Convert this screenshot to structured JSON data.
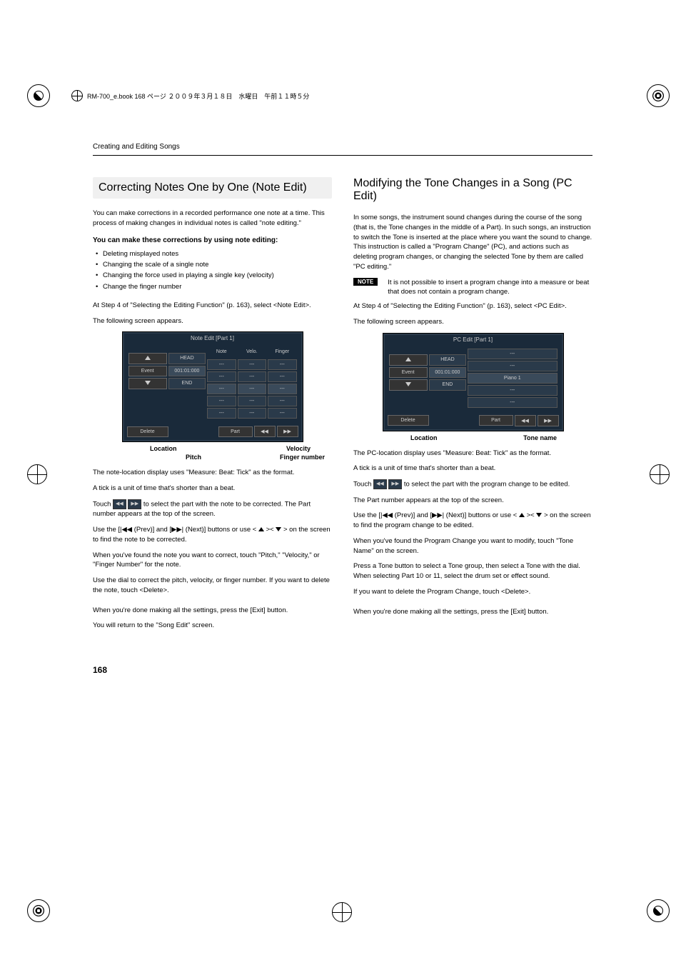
{
  "print_header": "RM-700_e.book  168 ページ  ２００９年３月１８日　水曜日　午前１１時５分",
  "header": "Creating and Editing Songs",
  "left": {
    "title": "Correcting Notes One by One (Note Edit)",
    "intro": "You can make corrections in a recorded performance one note at a time. This process of making changes in individual notes is called \"note editing.\"",
    "bold": "You can make these corrections by using note editing:",
    "bullets": [
      "Deleting misplayed notes",
      "Changing the scale of a single note",
      "Changing the force used in playing a single key (velocity)",
      "Change the finger number"
    ],
    "step": "At Step 4 of \"Selecting the Editing Function\" (p. 163), select <Note Edit>.",
    "appears": "The following screen appears.",
    "screen": {
      "title": "Note Edit [Part 1]",
      "hdr": [
        "Note",
        "Velo.",
        "Finger"
      ],
      "rows": [
        {
          "b": "",
          "l": "",
          "c": [
            "---",
            "---",
            "---"
          ]
        },
        {
          "b": "↑",
          "l": "HEAD",
          "c": [
            "---",
            "---",
            "---"
          ]
        },
        {
          "b": "Event",
          "l": "001:01:000",
          "c": [
            "---",
            "---",
            "---"
          ],
          "sel": true
        },
        {
          "b": "↓",
          "l": "END",
          "c": [
            "---",
            "---",
            "---"
          ]
        },
        {
          "b": "",
          "l": "",
          "c": [
            "---",
            "---",
            "---"
          ]
        }
      ],
      "delete": "Delete",
      "part": "Part"
    },
    "lbl_location": "Location",
    "lbl_velocity": "Velocity",
    "lbl_pitch": "Pitch",
    "lbl_finger": "Finger number",
    "p1": "The note-location display uses \"Measure: Beat: Tick\" as the format.",
    "p2": "A tick is a unit of time that's shorter than a beat.",
    "p3a": "Touch ",
    "p3b": " to select the part with the note to be corrected. The Part number appears at the top of the screen.",
    "p4a": "Use the [",
    "p4b": " (Prev)] and [",
    "p4c": " (Next)] buttons or use < ",
    "p4d": " >< ",
    "p4e": " > on the screen to find the note to be corrected.",
    "p5": "When you've found the note you want to correct, touch \"Pitch,\" \"Velocity,\" or \"Finger Number\" for the note.",
    "p6": "Use the dial to correct the pitch, velocity, or finger number. If you want to delete the note, touch <Delete>.",
    "p7": "When you're done making all the settings, press the [Exit] button.",
    "p8": "You will return to the \"Song Edit\" screen."
  },
  "right": {
    "title": "Modifying the Tone Changes in a Song (PC Edit)",
    "intro": "In some songs, the instrument sound changes during the course of the song (that is, the Tone changes in the middle of a Part). In such songs, an instruction to switch the Tone is inserted at the place where you want the sound to change. This instruction is called a \"Program Change\" (PC), and actions such as deleting program changes, or changing the selected Tone by them are called \"PC editing.\"",
    "note_label": "NOTE",
    "note": "It is not possible to insert a program change into a measure or beat that does not contain a program change.",
    "step": "At Step 4 of \"Selecting the Editing Function\" (p. 163), select <PC Edit>.",
    "appears": "The following screen appears.",
    "screen": {
      "title": "PC Edit [Part 1]",
      "rows": [
        {
          "b": "",
          "l": "",
          "c": "---"
        },
        {
          "b": "↑",
          "l": "HEAD",
          "c": "---"
        },
        {
          "b": "Event",
          "l": "001:01:000",
          "c": "Piano 1",
          "sel": true
        },
        {
          "b": "↓",
          "l": "END",
          "c": "---"
        },
        {
          "b": "",
          "l": "",
          "c": "---"
        }
      ],
      "delete": "Delete",
      "part": "Part"
    },
    "lbl_location": "Location",
    "lbl_tone": "Tone name",
    "p1": "The PC-location display uses \"Measure: Beat: Tick\" as the format.",
    "p2": "A tick is a unit of time that's shorter than a beat.",
    "p3a": "Touch ",
    "p3b": " to select the part with the program change to be edited.",
    "p3c": "The Part number appears at the top of the screen.",
    "p4a": "Use the [",
    "p4b": " (Prev)] and [",
    "p4c": " (Next)] buttons or use < ",
    "p4d": " >< ",
    "p4e": " > on the screen to find the program change to be edited.",
    "p5": "When you've found the Program Change you want to modify, touch \"Tone Name\" on the screen.",
    "p6": "Press a Tone button to select a Tone group, then select a Tone with the dial. When selecting Part 10 or 11, select the drum set or effect sound.",
    "p7": "If you want to delete the Program Change, touch <Delete>.",
    "p8": "When you're done making all the settings, press the [Exit] button."
  },
  "pagenum": "168"
}
